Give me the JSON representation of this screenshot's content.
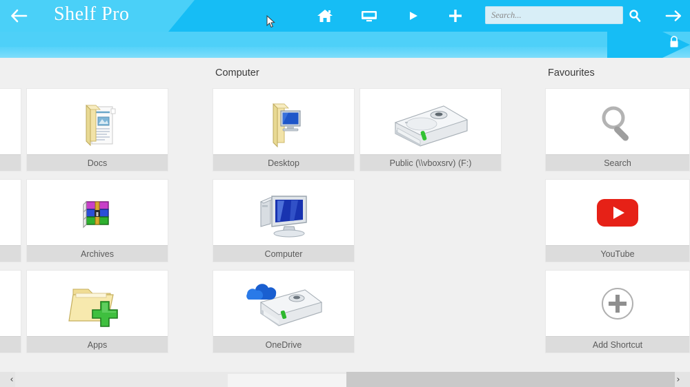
{
  "header": {
    "title": "Shelf Pro",
    "back_icon": "back-arrow-icon",
    "tools": [
      {
        "name": "home-icon",
        "label": "Home"
      },
      {
        "name": "monitor-icon",
        "label": "Display"
      },
      {
        "name": "play-icon",
        "label": "Play"
      },
      {
        "name": "plus-icon",
        "label": "Add"
      }
    ],
    "search": {
      "placeholder": "Search...",
      "value": "",
      "search_icon": "magnifier-icon"
    },
    "forward_icon": "forward-arrow-icon",
    "lock_icon": "lock-icon",
    "accent_color": "#16bdf5",
    "accent_light": "#4ad0f8"
  },
  "columns": [
    {
      "id": "partial",
      "title": "",
      "tiles": [
        {
          "label": "",
          "icon": "blank-icon"
        },
        {
          "label": "",
          "icon": "blank-icon"
        },
        {
          "label": "",
          "icon": "blank-icon"
        }
      ]
    },
    {
      "id": "left",
      "title": "",
      "tiles": [
        {
          "label": "Docs",
          "icon": "documents-folder-icon"
        },
        {
          "label": "Archives",
          "icon": "winrar-archive-icon"
        },
        {
          "label": "Apps",
          "icon": "add-folder-icon"
        }
      ]
    },
    {
      "id": "computer",
      "title": "Computer",
      "tiles": [
        {
          "label": "Desktop",
          "icon": "desktop-folder-icon"
        },
        {
          "label": "Computer",
          "icon": "computer-monitor-icon"
        },
        {
          "label": "OneDrive",
          "icon": "onedrive-drive-icon"
        }
      ]
    },
    {
      "id": "drives",
      "title": "",
      "tiles": [
        {
          "label": "Public (\\\\vboxsrv) (F:)",
          "icon": "hard-drive-icon"
        }
      ]
    },
    {
      "id": "favourites",
      "title": "Favourites",
      "tiles": [
        {
          "label": "Search",
          "icon": "magnifier-icon"
        },
        {
          "label": "YouTube",
          "icon": "youtube-icon"
        },
        {
          "label": "Add Shortcut",
          "icon": "circle-plus-icon"
        }
      ]
    }
  ],
  "scrollbar": {
    "left_arrow": "‹",
    "right_arrow": "›"
  },
  "colors": {
    "tile_bg": "#ffffff",
    "label_bg": "#dcdcdc",
    "page_bg": "#f0f0f0",
    "youtube_red": "#e62117"
  }
}
